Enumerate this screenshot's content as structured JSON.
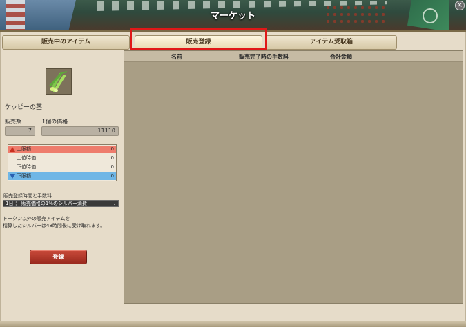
{
  "window": {
    "title": "マーケット"
  },
  "tabs": [
    {
      "label": "販売中のアイテム",
      "active": false
    },
    {
      "label": "販売登録",
      "active": true
    },
    {
      "label": "アイテム受取箱",
      "active": false
    }
  ],
  "item": {
    "name": "ケッピーの茎",
    "icon": "herb-stalk-icon"
  },
  "form": {
    "quantity_label": "販売数",
    "quantity_value": "7",
    "unit_price_label": "1個の価格",
    "unit_price_value": "11110"
  },
  "price_table": {
    "upper_limit_label": "上限額",
    "upper_limit_value": "0",
    "upper_price_label": "上位時価",
    "upper_price_value": "0",
    "lower_price_label": "下位時価",
    "lower_price_value": "0",
    "lower_limit_label": "下限額",
    "lower_limit_value": "0"
  },
  "duration": {
    "label": "販売登録時間と手数料",
    "selected": "1日 ： 販売価格の1%のシルバー消費"
  },
  "notice": {
    "line1": "トークン以外の販売アイテムを",
    "line2": "精算したシルバーは48時間後に受け取れます。"
  },
  "register_button": "登録",
  "table": {
    "headers": [
      "名前",
      "販売完了時の手数料",
      "合計金額"
    ]
  }
}
